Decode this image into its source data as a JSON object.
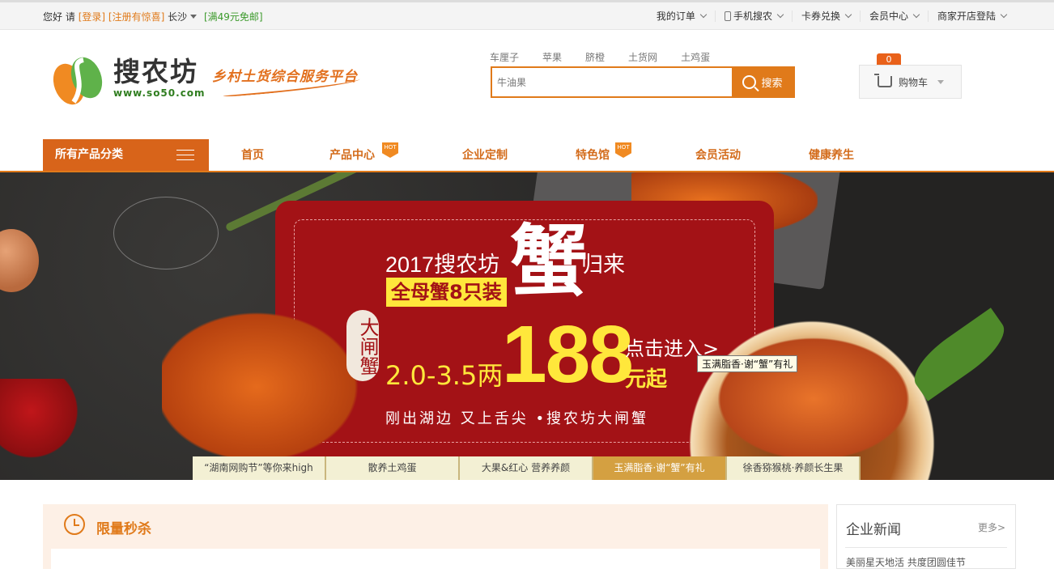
{
  "topbar": {
    "greeting": "您好",
    "please": "请",
    "login": "[登录]",
    "register": "[注册有惊喜]",
    "city": "长沙",
    "promo": "[满49元免邮]",
    "links": [
      "我的订单",
      "手机搜农",
      "卡券兑换",
      "会员中心",
      "商家开店登陆"
    ]
  },
  "brand": {
    "name": "搜农坊",
    "url": "www.so50.com",
    "slogan": "乡村土货综合服务平台"
  },
  "search": {
    "hot_words": [
      "车厘子",
      "苹果",
      "脐橙",
      "土货网",
      "土鸡蛋"
    ],
    "placeholder": "牛油果",
    "button": "搜索"
  },
  "cart": {
    "count": "0",
    "label": "购物车"
  },
  "nav": {
    "all_categories": "所有产品分类",
    "items": [
      "首页",
      "产品中心",
      "企业定制",
      "特色馆",
      "会员活动",
      "健康养生"
    ],
    "hot_badge": "HOT"
  },
  "banner": {
    "title_left": "2017搜农坊",
    "title_big": "蟹",
    "title_right": "归来",
    "tag": "全母蟹8只装",
    "seal": "大闸蟹",
    "weight": "2.0-3.5两",
    "price": "188",
    "enter": "点击进入>",
    "unit": "元起",
    "subtitle": "刚出湖边  又上舌尖  •搜农坊大闸蟹",
    "tooltip": "玉满脂香·谢“蟹”有礼",
    "tabs": [
      "“湖南网购节”等你来high",
      "散养土鸡蛋",
      "大果&红心 营养养颜",
      "玉满脂香·谢“蟹”有礼",
      "徐香猕猴桃·养颜长生果"
    ],
    "active_tab": 3
  },
  "sections": {
    "flash_sale": "限量秒杀",
    "news_title": "企业新闻",
    "news_more": "更多>",
    "news_snippet": "美丽星天地活  共度团圆佳节"
  },
  "colors": {
    "accent": "#e07a1a",
    "nav_dark": "#d8641a",
    "banner_red": "#a31216",
    "banner_yellow": "#ffe73b",
    "tab_bg": "#f3f0d4",
    "tab_active": "#d4a041"
  }
}
